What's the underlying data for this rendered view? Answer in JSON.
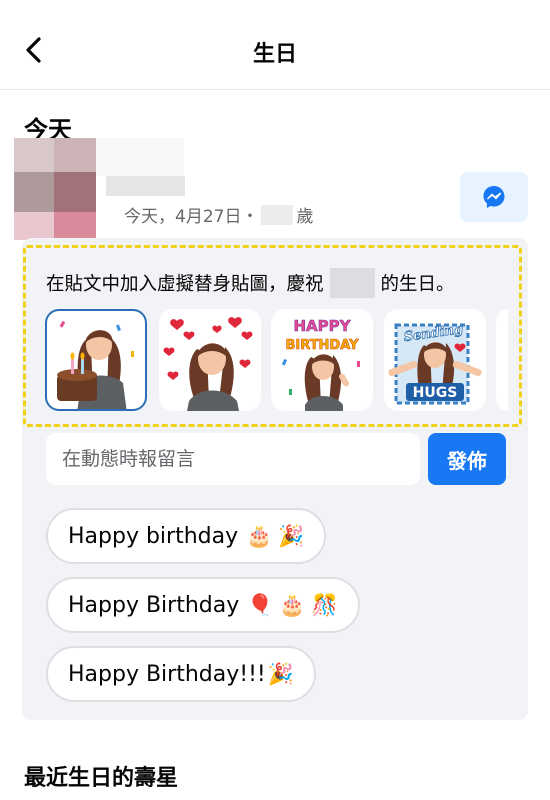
{
  "header": {
    "title": "生日"
  },
  "today_section": {
    "heading": "今天"
  },
  "person": {
    "date_prefix": "今天，4月27日・",
    "age_suffix": "歲"
  },
  "promo": {
    "text_before": "在貼文中加入虛擬替身貼圖，慶祝",
    "text_after": "的生日。"
  },
  "stickers": [
    {
      "name": "cake",
      "caption": ""
    },
    {
      "name": "hearts",
      "caption": ""
    },
    {
      "name": "happy-birthday",
      "caption": "HAPPY BIRTHDAY"
    },
    {
      "name": "sending-hugs",
      "caption_top": "Sending",
      "caption_bottom": "HUGS"
    }
  ],
  "comment": {
    "placeholder": "在動態時報留言",
    "post_label": "發佈"
  },
  "quick_replies": [
    {
      "text": "Happy birthday",
      "emoji": [
        "🎂",
        "🎉"
      ]
    },
    {
      "text": "Happy Birthday",
      "emoji": [
        "🎈",
        "🎂",
        "🎊"
      ]
    },
    {
      "text": "Happy Birthday!!!",
      "emoji": [
        "🎉"
      ]
    }
  ],
  "recent_section": {
    "heading": "最近生日的壽星"
  },
  "colors": {
    "accent": "#1877f2",
    "card_bg": "#f2f3f6",
    "highlight_border": "#f0d21a",
    "messenger_bg": "#e7f3ff"
  }
}
